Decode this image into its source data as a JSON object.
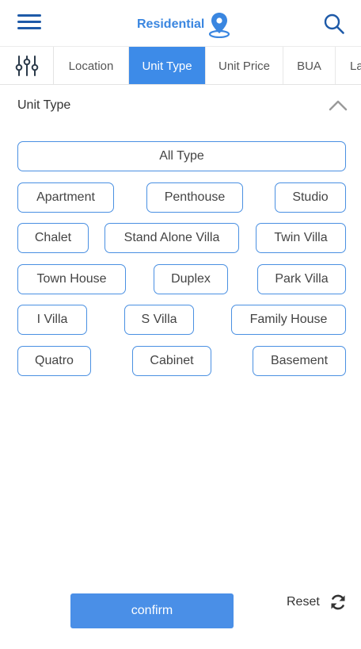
{
  "header": {
    "title": "Residential",
    "menu_icon": "hamburger-menu-icon",
    "location_icon": "map-pin-icon",
    "search_icon": "search-icon"
  },
  "tabs": {
    "filter_icon": "sliders-icon",
    "items": [
      {
        "label": "Location"
      },
      {
        "label": "Unit Type",
        "active": true
      },
      {
        "label": "Unit Price"
      },
      {
        "label": "BUA"
      },
      {
        "label": "La"
      }
    ]
  },
  "section": {
    "title": "Unit Type",
    "collapse_icon": "chevron-up-icon"
  },
  "unit_types": [
    "All Type",
    "Apartment",
    "Penthouse",
    "Studio",
    "Chalet",
    "Stand Alone Villa",
    "Twin Villa",
    "Town House",
    "Duplex",
    "Park Villa",
    "I Villa",
    "S Villa",
    "Family House",
    "Quatro",
    "Cabinet",
    "Basement"
  ],
  "footer": {
    "confirm_label": "confirm",
    "reset_label": "Reset",
    "reset_icon": "refresh-icon"
  },
  "colors": {
    "accent": "#3d8be8",
    "chip_border": "#4a90e2",
    "title": "#3a86e0"
  }
}
